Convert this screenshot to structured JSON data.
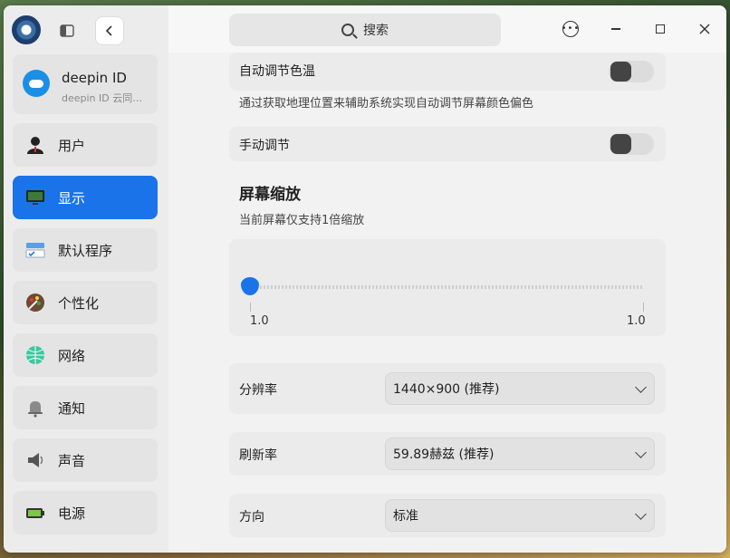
{
  "header": {
    "search_placeholder": "搜索"
  },
  "sidebar": {
    "account": {
      "name": "deepin ID",
      "subtitle": "deepin ID 云同…"
    },
    "items": [
      {
        "label": "用户",
        "icon": "user-icon"
      },
      {
        "label": "显示",
        "icon": "display-icon",
        "active": true
      },
      {
        "label": "默认程序",
        "icon": "default-apps-icon"
      },
      {
        "label": "个性化",
        "icon": "personalization-icon"
      },
      {
        "label": "网络",
        "icon": "network-icon"
      },
      {
        "label": "通知",
        "icon": "bell-icon"
      },
      {
        "label": "声音",
        "icon": "speaker-icon"
      },
      {
        "label": "电源",
        "icon": "battery-icon"
      }
    ]
  },
  "display": {
    "auto_color_temp": {
      "label": "自动调节色温",
      "enabled": false
    },
    "auto_color_temp_desc": "通过获取地理位置来辅助系统实现自动调节屏幕颜色偏色",
    "manual_adjust": {
      "label": "手动调节",
      "enabled": false
    },
    "scaling": {
      "title": "屏幕缩放",
      "desc": "当前屏幕仅支持1倍缩放",
      "min_label": "1.0",
      "max_label": "1.0",
      "value": 1.0
    },
    "resolution": {
      "label": "分辨率",
      "value": "1440×900 (推荐)"
    },
    "refresh_rate": {
      "label": "刷新率",
      "value": "59.89赫兹 (推荐)"
    },
    "orientation": {
      "label": "方向",
      "value": "标准"
    }
  },
  "colors": {
    "accent": "#1a73e8"
  }
}
